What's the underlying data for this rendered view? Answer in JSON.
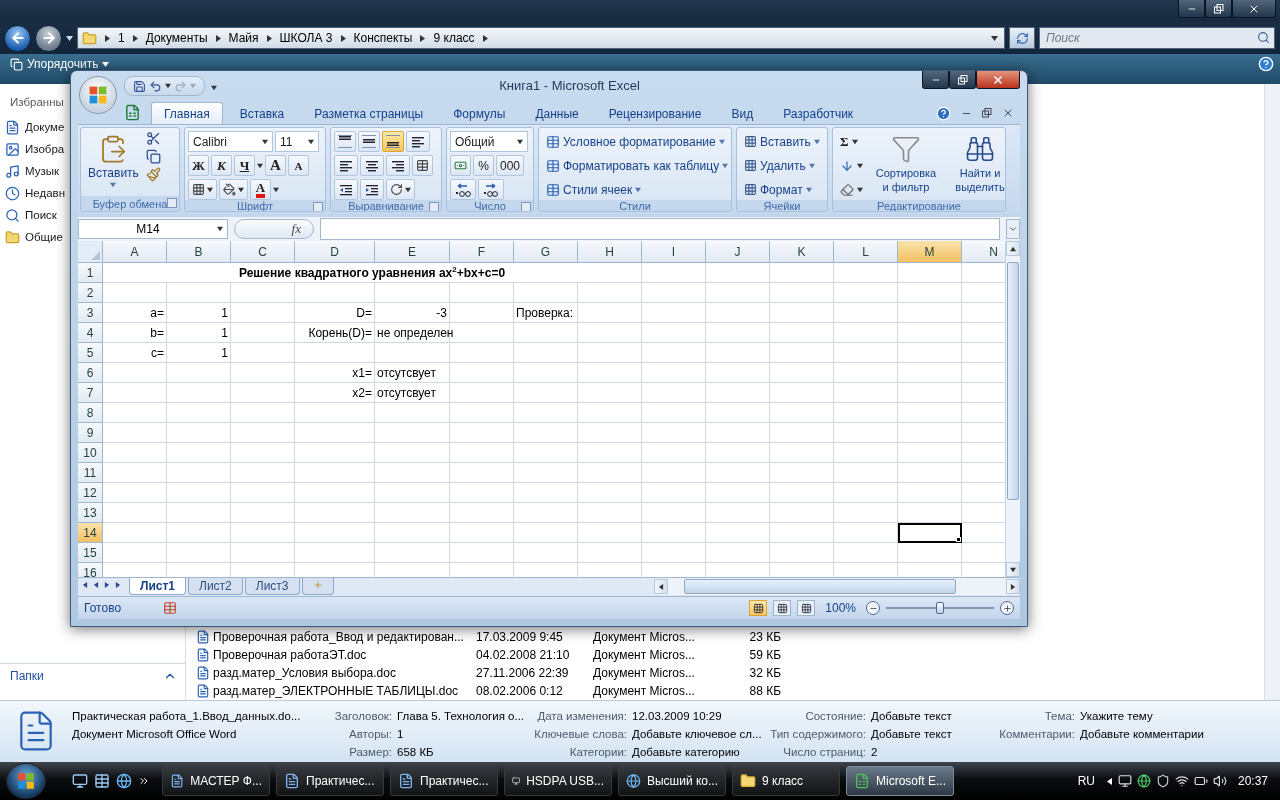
{
  "explorer": {
    "navigation": [
      {
        "kind": "back",
        "disabled": false
      },
      {
        "kind": "forward",
        "disabled": true
      }
    ],
    "breadcrumb": [
      "1",
      "Документы",
      "Майя",
      "ШКОЛА 3",
      "Конспекты",
      "9 класс"
    ],
    "search": {
      "placeholder": "Поиск"
    },
    "toolbar": [
      "Упорядочить"
    ],
    "favorites_title": "Избранны",
    "favorites": [
      {
        "label": "Докуме",
        "kind": "documents"
      },
      {
        "label": "Изобра",
        "kind": "pictures"
      },
      {
        "label": "Музык",
        "kind": "music"
      },
      {
        "label": "Недавн",
        "kind": "recent"
      },
      {
        "label": "Поиск",
        "kind": "search"
      },
      {
        "label": "Общие",
        "kind": "public"
      }
    ],
    "folders_label": "Папки",
    "files": [
      {
        "name": "Проверочная работа_Ввод и редактирован...",
        "date": "17.03.2009 9:45",
        "type": "Документ Micros...",
        "size": "23 КБ"
      },
      {
        "name": "Проверочная работаЭТ.doc",
        "date": "04.02.2008 21:10",
        "type": "Документ Micros...",
        "size": "59 КБ"
      },
      {
        "name": "разд.матер_Условия выбора.doc",
        "date": "27.11.2006 22:39",
        "type": "Документ Micros...",
        "size": "32 КБ"
      },
      {
        "name": "разд.матер_ЭЛЕКТРОННЫЕ ТАБЛИЦЫ.doc",
        "date": "08.02.2006 0:12",
        "type": "Документ Micros...",
        "size": "88 КБ"
      }
    ],
    "details": {
      "name": "Практическая работа_1.Ввод_данных.do...",
      "type": "Документ Microsoft Office Word",
      "columns": [
        [
          {
            "label": "Заголовок:",
            "value": "Глава 5. Технология о..."
          },
          {
            "label": "Авторы:",
            "value": "1"
          },
          {
            "label": "Размер:",
            "value": "658 КБ"
          }
        ],
        [
          {
            "label": "Дата изменения:",
            "value": "12.03.2009 10:29"
          },
          {
            "label": "Ключевые слова:",
            "value": "Добавьте ключевое сл..."
          },
          {
            "label": "Категории:",
            "value": "Добавьте категорию"
          }
        ],
        [
          {
            "label": "Состояние:",
            "value": "Добавьте текст"
          },
          {
            "label": "Тип содержимого:",
            "value": "Добавьте текст"
          },
          {
            "label": "Число страниц:",
            "value": "2"
          }
        ],
        [
          {
            "label": "Тема:",
            "value": "Укажите тему"
          },
          {
            "label": "Комментарии:",
            "value": "Добавьте комментарии"
          }
        ]
      ]
    }
  },
  "excel": {
    "title": "Книга1 - Microsoft Excel",
    "tabs": [
      {
        "label": "Главная",
        "selected": true
      },
      {
        "label": "Вставка",
        "selected": false
      },
      {
        "label": "Разметка страницы",
        "selected": false
      },
      {
        "label": "Формулы",
        "selected": false
      },
      {
        "label": "Данные",
        "selected": false
      },
      {
        "label": "Рецензирование",
        "selected": false
      },
      {
        "label": "Вид",
        "selected": false
      },
      {
        "label": "Разработчик",
        "selected": false
      }
    ],
    "clipboard": {
      "paste": "Вставить",
      "group": "Буфер обмена"
    },
    "font": {
      "name": "Calibri",
      "size": "11",
      "bold": "Ж",
      "italic": "К",
      "underline": "Ч",
      "grow": "A",
      "shrink": "A",
      "color_button": "A",
      "group": "Шрифт"
    },
    "alignment": {
      "vertical": [
        {
          "selected": false
        },
        {
          "selected": false
        },
        {
          "selected": true
        }
      ],
      "group": "Выравнивание"
    },
    "number": {
      "format": "Общий",
      "percent": "%",
      "thousands": "000",
      "group": "Число"
    },
    "styles": {
      "commands": [
        "Условное форматирование",
        "Форматировать как таблицу",
        "Стили ячеек"
      ],
      "group": "Стили"
    },
    "cells": {
      "commands": [
        "Вставить",
        "Удалить",
        "Формат"
      ],
      "group": "Ячейки"
    },
    "editing": {
      "sum": "Σ",
      "sort": "Сортировка и фильтр",
      "find": "Найти и выделить",
      "group": "Редактирование"
    },
    "name_box": "M14",
    "fx": "fx",
    "columns": [
      {
        "label": "A",
        "selected": false
      },
      {
        "label": "B",
        "selected": false
      },
      {
        "label": "C",
        "selected": false
      },
      {
        "label": "D",
        "selected": false
      },
      {
        "label": "E",
        "selected": false
      },
      {
        "label": "F",
        "selected": false
      },
      {
        "label": "G",
        "selected": false
      },
      {
        "label": "H",
        "selected": false
      },
      {
        "label": "I",
        "selected": false
      },
      {
        "label": "J",
        "selected": false
      },
      {
        "label": "K",
        "selected": false
      },
      {
        "label": "L",
        "selected": false
      },
      {
        "label": "M",
        "selected": true
      },
      {
        "label": "N",
        "selected": false
      }
    ],
    "rows": [
      {
        "label": "1",
        "selected": false,
        "title": "Решение квадратного уравнения ax$^{2}$+bx+c=0"
      },
      {
        "label": "2",
        "selected": false
      },
      {
        "label": "3",
        "selected": false,
        "cells": [
          {
            "kind": "label",
            "text": "a="
          },
          {
            "kind": "number",
            "text": "1"
          },
          null,
          {
            "kind": "label",
            "text": "D="
          },
          {
            "kind": "number",
            "text": "-3"
          },
          null,
          {
            "kind": "text",
            "text": "Проверка:"
          }
        ]
      },
      {
        "label": "4",
        "selected": false,
        "cells": [
          {
            "kind": "label",
            "text": "b="
          },
          {
            "kind": "number",
            "text": "1"
          },
          null,
          {
            "kind": "label",
            "text": "Корень(D)="
          },
          {
            "kind": "text",
            "text": "не определен"
          }
        ]
      },
      {
        "label": "5",
        "selected": false,
        "cells": [
          {
            "kind": "label",
            "text": "c="
          },
          {
            "kind": "number",
            "text": "1"
          }
        ]
      },
      {
        "label": "6",
        "selected": false,
        "cells": [
          null,
          null,
          null,
          {
            "kind": "label",
            "text": "x1="
          },
          {
            "kind": "text",
            "text": "отсутсвует"
          }
        ]
      },
      {
        "label": "7",
        "selected": false,
        "cells": [
          null,
          null,
          null,
          {
            "kind": "label",
            "text": "x2="
          },
          {
            "kind": "text",
            "text": "отсутсвует"
          }
        ]
      },
      {
        "label": "8",
        "selected": false
      },
      {
        "label": "9",
        "selected": false
      },
      {
        "label": "10",
        "selected": false
      },
      {
        "label": "11",
        "selected": false
      },
      {
        "label": "12",
        "selected": false
      },
      {
        "label": "13",
        "selected": false
      },
      {
        "label": "14",
        "selected": true
      },
      {
        "label": "15",
        "selected": false
      },
      {
        "label": "16",
        "selected": false
      }
    ],
    "sheets": [
      {
        "label": "Лист1",
        "selected": true
      },
      {
        "label": "Лист2",
        "selected": false
      },
      {
        "label": "Лист3",
        "selected": false
      }
    ],
    "status": "Готово",
    "views": [
      {
        "selected": true
      },
      {
        "selected": false
      },
      {
        "selected": false
      }
    ],
    "zoom": {
      "reading": "100%",
      "level": 0.5
    }
  },
  "taskbar": {
    "tasks": [
      {
        "label": "МАСТЕР Ф...",
        "kind": "word",
        "selected": false
      },
      {
        "label": "Практичес...",
        "kind": "word",
        "selected": false
      },
      {
        "label": "Практичес...",
        "kind": "word",
        "selected": false
      },
      {
        "label": "HSDPA USB...",
        "kind": "app",
        "selected": false
      },
      {
        "label": "Высший ко...",
        "kind": "browser",
        "selected": false
      },
      {
        "label": "9 класс",
        "kind": "folder",
        "selected": false
      },
      {
        "label": "Microsoft E...",
        "kind": "excel",
        "selected": true
      }
    ],
    "language": "RU",
    "clock": "20:37"
  }
}
